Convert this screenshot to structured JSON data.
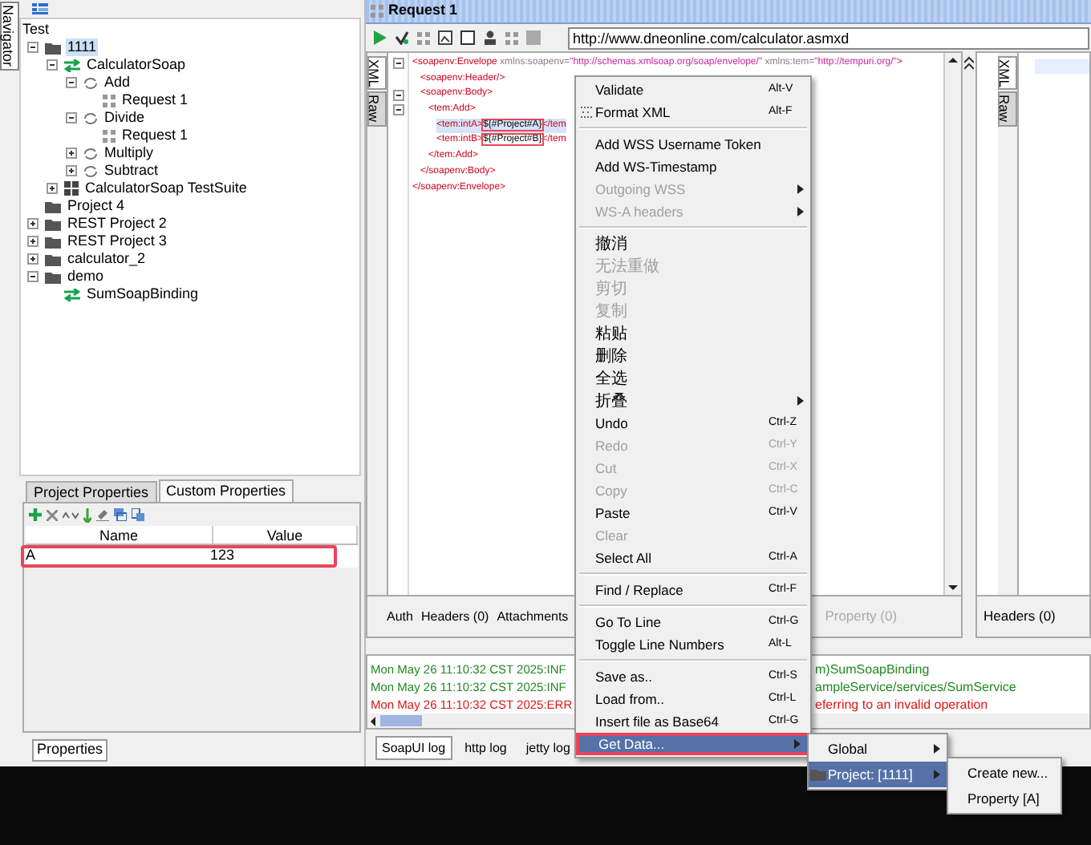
{
  "navigator_tab": "Navigator",
  "tree": {
    "root": "Test",
    "items": [
      {
        "label": "1111",
        "kind": "project",
        "expanded": true,
        "selected": true,
        "children": [
          {
            "label": "CalculatorSoap",
            "kind": "interface",
            "expanded": true,
            "selected": false,
            "children": [
              {
                "label": "Add",
                "kind": "operation",
                "expanded": true,
                "selected": false,
                "children": [
                  {
                    "label": "Request 1",
                    "kind": "request",
                    "selected": false
                  }
                ]
              },
              {
                "label": "Divide",
                "kind": "operation",
                "expanded": true,
                "selected": false,
                "children": [
                  {
                    "label": "Request 1",
                    "kind": "request",
                    "selected": false
                  }
                ]
              },
              {
                "label": "Multiply",
                "kind": "operation",
                "expanded": false,
                "selected": false
              },
              {
                "label": "Subtract",
                "kind": "operation",
                "expanded": false,
                "selected": false
              }
            ]
          },
          {
            "label": "CalculatorSoap TestSuite",
            "kind": "testsuite",
            "expanded": false,
            "selected": false
          }
        ]
      },
      {
        "label": "Project 4",
        "kind": "project",
        "selected": false
      },
      {
        "label": "REST Project 2",
        "kind": "project",
        "expanded": false,
        "selected": false
      },
      {
        "label": "REST Project 3",
        "kind": "project",
        "expanded": false,
        "selected": false
      },
      {
        "label": "calculator_2",
        "kind": "project",
        "expanded": false,
        "selected": false
      },
      {
        "label": "demo",
        "kind": "project",
        "expanded": true,
        "selected": false,
        "children": [
          {
            "label": "SumSoapBinding",
            "kind": "interface",
            "selected": false
          }
        ]
      }
    ]
  },
  "properties_panel": {
    "tabs": [
      {
        "label": "Project Properties",
        "selected": false
      },
      {
        "label": "Custom Properties",
        "selected": true
      }
    ],
    "columns": [
      "Name",
      "Value"
    ],
    "rows": [
      {
        "cells": [
          "A",
          "123"
        ],
        "outlined": true
      }
    ]
  },
  "properties_button": "Properties",
  "request": {
    "title": "Request 1",
    "url": "http://www.dneonline.com/calculator.asmxd",
    "editor_tabs": [
      {
        "label": "XML",
        "selected": true
      },
      {
        "label": "Raw",
        "selected": false
      }
    ],
    "xml": [
      {
        "current": false,
        "tokens": [
          {
            "kind": "tag",
            "text": "<soapenv:Envelope "
          },
          {
            "kind": "attr",
            "text": "xmlns:soapenv="
          },
          {
            "kind": "value",
            "text": "\"http://schemas.xmlsoap.org/soap/envelope/\" "
          },
          {
            "kind": "attr",
            "text": "xmlns:tem="
          },
          {
            "kind": "value",
            "text": "\"http://tempuri.org/\""
          },
          {
            "kind": "tag",
            "text": ">"
          }
        ],
        "children": [
          {
            "current": false,
            "tokens": [
              {
                "kind": "tag",
                "text": "<soapenv:Header/>"
              }
            ]
          },
          {
            "current": false,
            "tokens": [
              {
                "kind": "tag",
                "text": "<soapenv:Body>"
              }
            ],
            "children": [
              {
                "current": false,
                "tokens": [
                  {
                    "kind": "tag",
                    "text": "<tem:Add>"
                  }
                ],
                "children": [
                  {
                    "current": true,
                    "tokens": [
                      {
                        "kind": "tag",
                        "text": "<tem:intA>"
                      },
                      {
                        "kind": "text",
                        "text": "${#Project#A}",
                        "outlined": true
                      },
                      {
                        "kind": "tag",
                        "text": "</tem"
                      }
                    ]
                  },
                  {
                    "current": false,
                    "tokens": [
                      {
                        "kind": "tag",
                        "text": "<tem:intB>"
                      },
                      {
                        "kind": "text",
                        "text": "${#Project#B}",
                        "outlined": true
                      },
                      {
                        "kind": "tag",
                        "text": "</tem"
                      }
                    ]
                  }
                ]
              },
              {
                "current": false,
                "tokens": [
                  {
                    "kind": "tag",
                    "text": "</tem:Add>"
                  }
                ]
              }
            ]
          },
          {
            "current": false,
            "tokens": [
              {
                "kind": "tag",
                "text": "</soapenv:Body>"
              }
            ]
          }
        ]
      },
      {
        "current": false,
        "tokens": [
          {
            "kind": "tag",
            "text": "</soapenv:Envelope>"
          }
        ]
      }
    ],
    "tabs_left": [
      {
        "label": "Auth",
        "disabled": false
      },
      {
        "label": "Headers (0)",
        "disabled": false
      },
      {
        "label": "Attachments",
        "disabled": false
      }
    ],
    "tabs_right": [
      {
        "label": "Property (0)",
        "disabled": true
      }
    ],
    "response_tabs": [
      {
        "label": "XML",
        "selected": true
      },
      {
        "label": "Raw",
        "selected": false
      }
    ],
    "response_bottom_tab": "Headers (0)"
  },
  "log": {
    "lines": [
      {
        "color": "#1f8a1f",
        "start": "Mon May 26 11:10:32 CST 2025:INF",
        "end": "m)SumSoapBinding"
      },
      {
        "color": "#1f8a1f",
        "start": "Mon May 26 11:10:32 CST 2025:INF",
        "end": "ampleService/services/SumService"
      },
      {
        "color": "#e01515",
        "start": "Mon May 26 11:10:32 CST 2025:ERR",
        "end": "eferring to an invalid operation"
      }
    ],
    "tabs": [
      {
        "label": "SoapUI log",
        "selected": true
      },
      {
        "label": "http log",
        "selected": false
      },
      {
        "label": "jetty log",
        "selected": false
      }
    ]
  },
  "context_menu": {
    "items": [
      {
        "kind": "item",
        "label": "Validate",
        "shortcut": "Alt-V",
        "disabled": false,
        "has_submenu": false,
        "selected": false
      },
      {
        "kind": "icon_item",
        "label": "Format XML",
        "shortcut": "Alt-F",
        "disabled": false,
        "has_submenu": false,
        "selected": false
      },
      {
        "kind": "separator"
      },
      {
        "kind": "item",
        "label": "Add WSS Username Token",
        "disabled": false,
        "has_submenu": false,
        "selected": false
      },
      {
        "kind": "item",
        "label": "Add WS-Timestamp",
        "disabled": false,
        "has_submenu": false,
        "selected": false
      },
      {
        "kind": "item",
        "label": "Outgoing WSS",
        "disabled": true,
        "has_submenu": true,
        "selected": false
      },
      {
        "kind": "item",
        "label": "WS-A headers",
        "disabled": true,
        "has_submenu": true,
        "selected": false
      },
      {
        "kind": "separator"
      },
      {
        "kind": "item",
        "label": "撤消",
        "disabled": false,
        "has_submenu": false,
        "selected": false
      },
      {
        "kind": "item",
        "label": "无法重做",
        "disabled": true,
        "has_submenu": false,
        "selected": false
      },
      {
        "kind": "item",
        "label": "剪切",
        "disabled": true,
        "has_submenu": false,
        "selected": false
      },
      {
        "kind": "item",
        "label": "复制",
        "disabled": true,
        "has_submenu": false,
        "selected": false
      },
      {
        "kind": "item",
        "label": "粘贴",
        "disabled": false,
        "has_submenu": false,
        "selected": false
      },
      {
        "kind": "item",
        "label": "删除",
        "disabled": false,
        "has_submenu": false,
        "selected": false
      },
      {
        "kind": "item",
        "label": "全选",
        "disabled": false,
        "has_submenu": false,
        "selected": false
      },
      {
        "kind": "item",
        "label": "折叠",
        "disabled": false,
        "has_submenu": true,
        "selected": false
      },
      {
        "kind": "item",
        "label": "Undo",
        "shortcut": "Ctrl-Z",
        "disabled": false,
        "has_submenu": false,
        "selected": false
      },
      {
        "kind": "item",
        "label": "Redo",
        "shortcut": "Ctrl-Y",
        "disabled": true,
        "has_submenu": false,
        "selected": false
      },
      {
        "kind": "item",
        "label": "Cut",
        "shortcut": "Ctrl-X",
        "disabled": true,
        "has_submenu": false,
        "selected": false
      },
      {
        "kind": "item",
        "label": "Copy",
        "shortcut": "Ctrl-C",
        "disabled": true,
        "has_submenu": false,
        "selected": false
      },
      {
        "kind": "item",
        "label": "Paste",
        "shortcut": "Ctrl-V",
        "disabled": false,
        "has_submenu": false,
        "selected": false
      },
      {
        "kind": "item",
        "label": "Clear",
        "disabled": true,
        "has_submenu": false,
        "selected": false
      },
      {
        "kind": "item",
        "label": "Select All",
        "shortcut": "Ctrl-A",
        "disabled": false,
        "has_submenu": false,
        "selected": false
      },
      {
        "kind": "separator"
      },
      {
        "kind": "item",
        "label": "Find / Replace",
        "shortcut": "Ctrl-F",
        "disabled": false,
        "has_submenu": false,
        "selected": false
      },
      {
        "kind": "separator"
      },
      {
        "kind": "item",
        "label": "Go To Line",
        "shortcut": "Ctrl-G",
        "disabled": false,
        "has_submenu": false,
        "selected": false
      },
      {
        "kind": "item",
        "label": "Toggle Line Numbers",
        "shortcut": "Alt-L",
        "disabled": false,
        "has_submenu": false,
        "selected": false
      },
      {
        "kind": "separator"
      },
      {
        "kind": "item",
        "label": "Save as..",
        "shortcut": "Ctrl-S",
        "disabled": false,
        "has_submenu": false,
        "selected": false
      },
      {
        "kind": "item",
        "label": "Load from..",
        "shortcut": "Ctrl-L",
        "disabled": false,
        "has_submenu": false,
        "selected": false
      },
      {
        "kind": "item",
        "label": "Insert file as Base64",
        "shortcut": "Ctrl-G",
        "disabled": false,
        "has_submenu": false,
        "selected": false
      },
      {
        "kind": "item",
        "label": "Get Data...",
        "disabled": false,
        "has_submenu": true,
        "selected": true,
        "outlined": true
      }
    ]
  },
  "submenu": {
    "items": [
      {
        "kind": "item",
        "label": "Global",
        "has_submenu": true,
        "selected": false
      },
      {
        "kind": "folder_item",
        "label": "Project: [1111]",
        "has_submenu": true,
        "selected": true
      }
    ]
  },
  "sub_submenu": {
    "items": [
      {
        "label": "Create new...",
        "has_submenu": false,
        "selected": false
      },
      {
        "label": "Property [A]",
        "has_submenu": false,
        "selected": false
      }
    ]
  }
}
